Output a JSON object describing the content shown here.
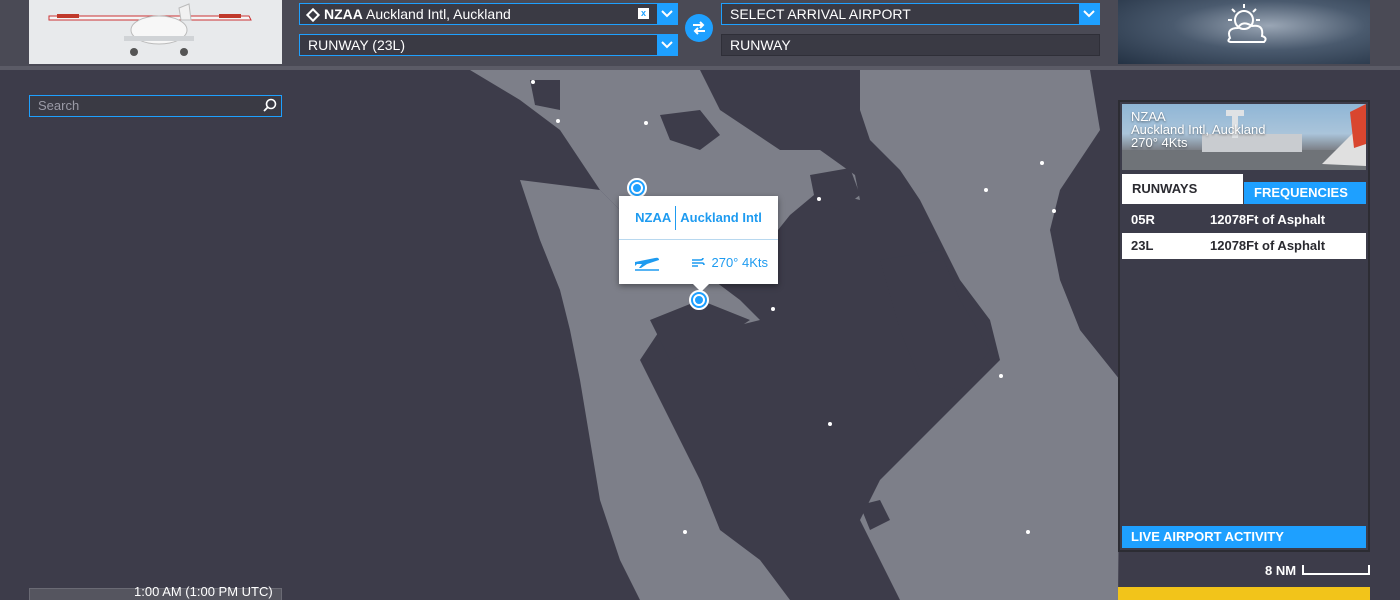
{
  "departure": {
    "code": "NZAA",
    "name": "Auckland Intl, Auckland",
    "runway": "RUNWAY (23L)",
    "clear_label": "x"
  },
  "arrival": {
    "placeholder": "SELECT ARRIVAL AIRPORT",
    "runway": "RUNWAY"
  },
  "search": {
    "placeholder": "Search"
  },
  "popup": {
    "code": "NZAA",
    "name": "Auckland Intl",
    "wind": "270° 4Kts"
  },
  "airport_panel": {
    "code": "NZAA",
    "name": "Auckland Intl, Auckland",
    "wind": "270° 4Kts",
    "tabs": [
      "RUNWAYS",
      "FREQUENCIES"
    ],
    "runways": [
      {
        "id": "05R",
        "length": "12078Ft of Asphalt"
      },
      {
        "id": "23L",
        "length": "12078Ft of Asphalt"
      }
    ],
    "live_activity": "LIVE AIRPORT ACTIVITY"
  },
  "scale": {
    "label": "8 NM"
  },
  "time": {
    "label": "1:00 AM (1:00 PM UTC)"
  },
  "colors": {
    "accent": "#1ea0ff",
    "land": "#7d7f89",
    "water": "#3d3c4a",
    "yellow": "#f2c41a"
  }
}
